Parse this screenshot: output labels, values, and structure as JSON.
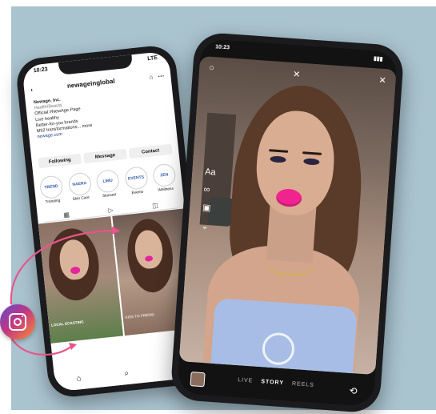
{
  "colors": {
    "background": "#a9c3cf",
    "arrow": "#e8558a",
    "lips": "#f0238f"
  },
  "left_phone": {
    "time": "10:23",
    "signal": "LTE",
    "header": {
      "back_icon": "chevron-left-icon",
      "username": "newageinglobal",
      "bell_icon": "bell-icon",
      "menu_icon": "more-icon"
    },
    "bio_lines": [
      "Newage, Inc.",
      "Health/Beauty",
      "Official #NewAge Page",
      "Live healthy",
      "Better-for-you brands",
      "M92 transformations... more",
      "newage.com"
    ],
    "buttons": [
      "Following",
      "Message",
      "Contact"
    ],
    "highlights": [
      {
        "label": "Trending",
        "mark": "TREND"
      },
      {
        "label": "Skin Care",
        "mark": "NAERA"
      },
      {
        "label": "Skinsetl",
        "mark": "LIMU"
      },
      {
        "label": "Events",
        "mark": "EVENTS"
      },
      {
        "label": "Wellness",
        "mark": "ZEN"
      }
    ],
    "tabs": [
      "grid-icon",
      "reels-icon",
      "tagged-icon"
    ],
    "tiles": [
      {
        "caption": "LOCAL ECASTING"
      },
      {
        "caption": "KISS TO FRIEND"
      }
    ],
    "bottom_nav": [
      "home-icon",
      "search-icon",
      "reels-icon"
    ]
  },
  "right_phone": {
    "time": "10:23",
    "top_icons": [
      "settings-icon",
      "flash-icon",
      "close-icon"
    ],
    "side_tools": [
      "Aa",
      "∞",
      "▣",
      "⌄"
    ],
    "modes": [
      "LIVE",
      "STORY",
      "REELS"
    ],
    "active_mode": "STORY",
    "flip_icon": "flip-camera-icon"
  },
  "badge": {
    "icon": "instagram-icon"
  }
}
